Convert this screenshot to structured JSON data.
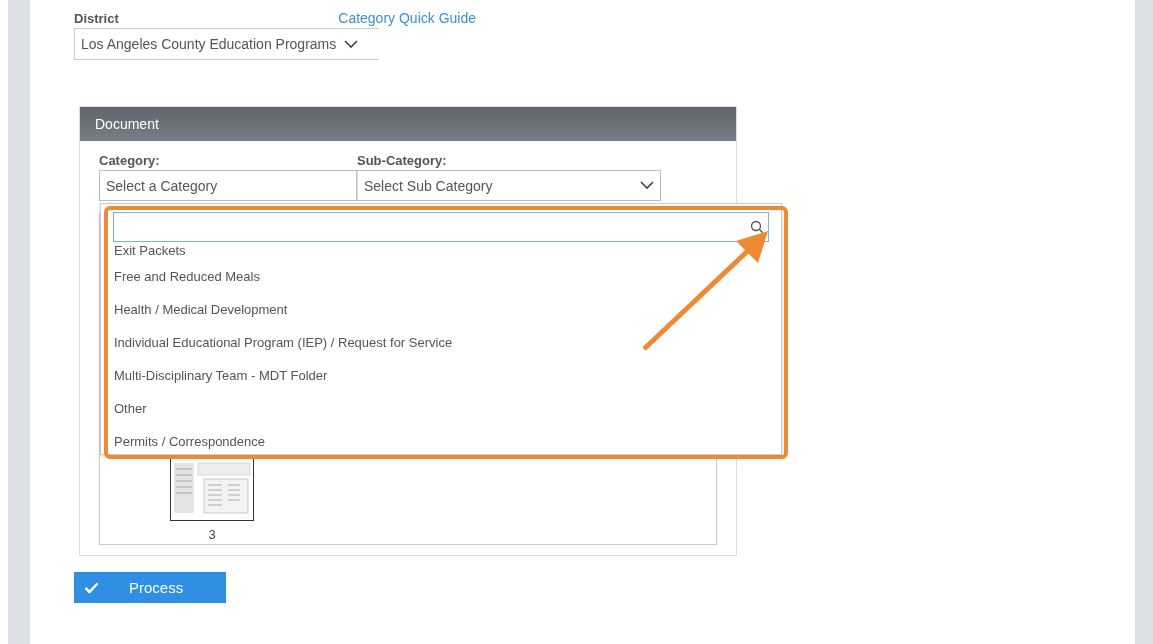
{
  "district": {
    "label": "District",
    "value": "Los Angeles County Education Programs",
    "link": "Category Quick Guide"
  },
  "document": {
    "title": "Document",
    "category": {
      "label": "Category:",
      "placeholder": "Select a Category"
    },
    "sub_category": {
      "label": "Sub-Category:",
      "placeholder": "Select Sub Category"
    },
    "dropdown": {
      "items": [
        {
          "label": "Exit Packets"
        },
        {
          "label": "Free and Reduced Meals"
        },
        {
          "label": "Health / Medical Development"
        },
        {
          "label": "Individual Educational Program (IEP) / Request for Service"
        },
        {
          "label": "Multi-Disciplinary Team - MDT Folder"
        },
        {
          "label": "Other"
        },
        {
          "label": "Permits / Correspondence"
        }
      ]
    },
    "pages": [
      {
        "number": "3"
      }
    ]
  },
  "process_button": "Process"
}
